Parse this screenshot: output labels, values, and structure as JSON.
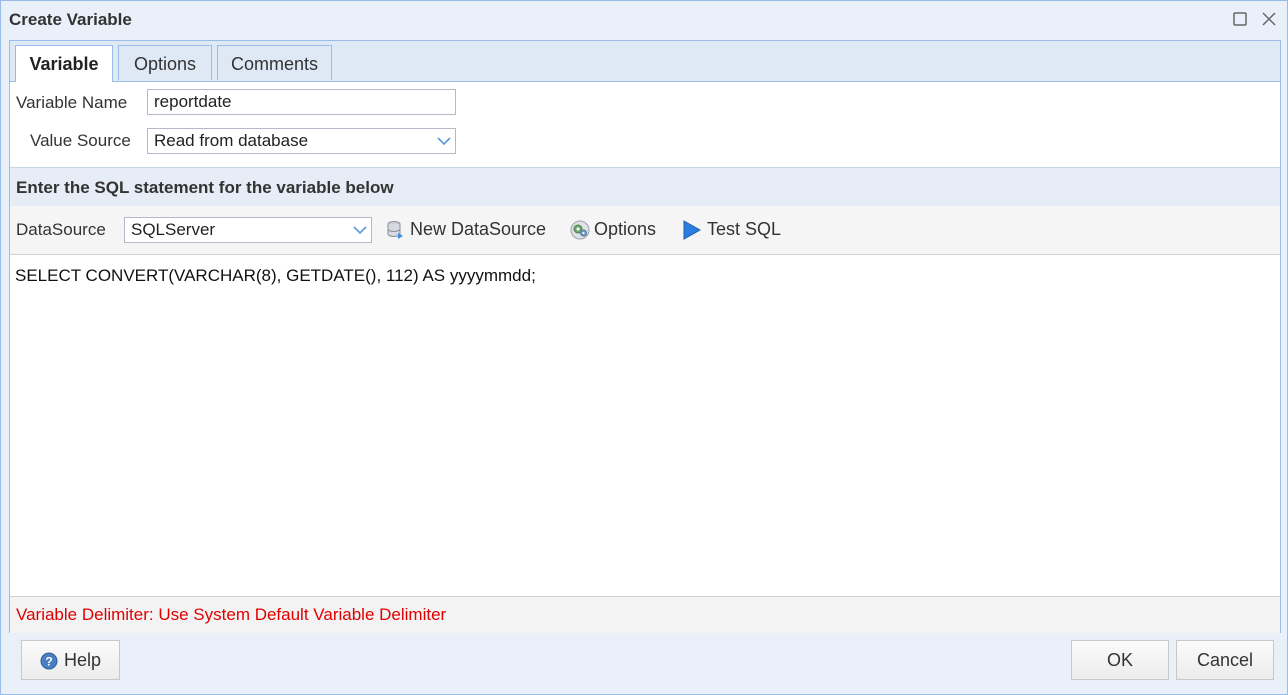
{
  "window": {
    "title": "Create Variable"
  },
  "tabs": [
    {
      "label": "Variable",
      "active": true
    },
    {
      "label": "Options",
      "active": false
    },
    {
      "label": "Comments",
      "active": false
    }
  ],
  "form": {
    "variable_name_label": "Variable Name",
    "variable_name_value": "reportdate",
    "value_source_label": "Value Source",
    "value_source_value": "Read from database"
  },
  "sql_section": {
    "heading": "Enter the SQL statement for the variable below"
  },
  "toolbar": {
    "datasource_label": "DataSource",
    "datasource_value": "SQLServer",
    "new_datasource": "New DataSource",
    "options": "Options",
    "test_sql": "Test SQL"
  },
  "editor": {
    "sql": "SELECT CONVERT(VARCHAR(8), GETDATE(), 112) AS yyyymmdd;"
  },
  "delimiter_text": "Variable Delimiter: Use System Default Variable Delimiter",
  "footer": {
    "help": "Help",
    "ok": "OK",
    "cancel": "Cancel"
  },
  "colors": {
    "accent_border": "#99bce8",
    "delimiter_text": "#e00000",
    "play_icon": "#2a7de1"
  }
}
